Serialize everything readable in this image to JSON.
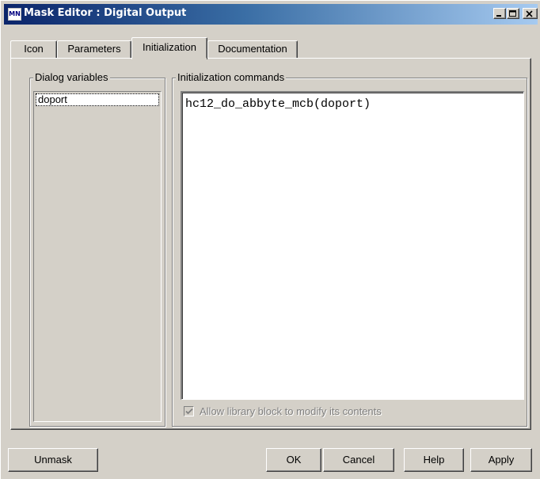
{
  "window": {
    "title": "Mask Editor : Digital Output",
    "app_icon": "simulink-mask-icon",
    "app_icon_text": "MN"
  },
  "tabs": [
    {
      "label": "Icon",
      "active": false
    },
    {
      "label": "Parameters",
      "active": false
    },
    {
      "label": "Initialization",
      "active": true
    },
    {
      "label": "Documentation",
      "active": false
    }
  ],
  "dialog_variables": {
    "legend": "Dialog variables",
    "items": [
      "doport"
    ]
  },
  "initialization": {
    "legend": "Initialization commands",
    "commands": "hc12_do_abbyte_mcb(doport)",
    "allow_modify_label": "Allow library block to modify its contents",
    "allow_modify_checked": true,
    "allow_modify_enabled": false
  },
  "buttons": {
    "unmask": "Unmask",
    "ok": "OK",
    "cancel": "Cancel",
    "help": "Help",
    "apply": "Apply"
  },
  "colors": {
    "title_bar_start": "#0a246a",
    "title_bar_end": "#a6caf0",
    "face": "#d4d0c8",
    "disabled_text": "#808080"
  }
}
